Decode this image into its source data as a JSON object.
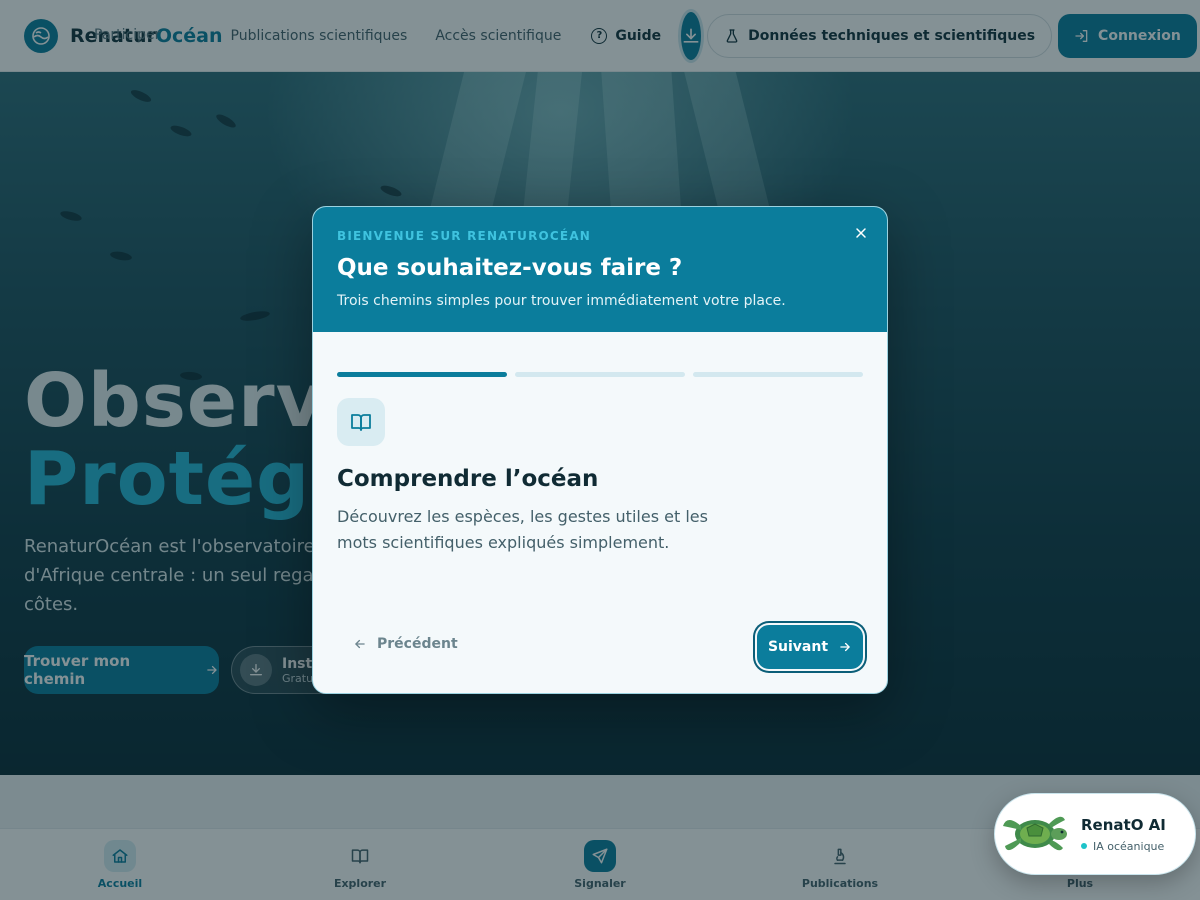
{
  "nav": {
    "brand_part1": "Renatur",
    "brand_part2": "Océan",
    "overlap_text": "Participer",
    "links": [
      "Participer",
      "Publications scientifiques",
      "Accès scientifique"
    ],
    "guide_label": "Guide",
    "tech_label": "Données techniques et scientifiques",
    "login_label": "Connexion"
  },
  "hero": {
    "title_line1": "Observer.",
    "title_line2": "Protéger.",
    "description": "RenaturOcéan est l'observatoire numérique des océans d'Afrique centrale : un seul regard sur la vie de nos côtes.",
    "cta_label": "Trouver mon chemin",
    "install_label": "Installer l'app",
    "install_sub": "Gratuit"
  },
  "modal": {
    "eyebrow": "BIENVENUE SUR RENATUROCÉAN",
    "title": "Que souhaitez-vous faire ?",
    "subtitle": "Trois chemins simples pour trouver immédiatement votre place.",
    "progress": {
      "current": 1,
      "total": 3
    },
    "step_title": "Comprendre l’océan",
    "step_description": "Découvrez les espèces, les gestes utiles et les mots scientifiques expliqués simplement.",
    "prev_label": "Précédent",
    "next_label": "Suivant"
  },
  "bottom_nav": {
    "items": [
      {
        "label": "Accueil",
        "icon": "home-icon",
        "active": true
      },
      {
        "label": "Explorer",
        "icon": "book-icon",
        "active": false
      },
      {
        "label": "Signaler",
        "icon": "send-icon",
        "active": false
      },
      {
        "label": "Publications",
        "icon": "microscope-icon",
        "active": false
      },
      {
        "label": "Plus",
        "icon": "more-icon",
        "active": false
      }
    ]
  },
  "chat": {
    "title": "RenatO AI",
    "subtitle": "IA océanique"
  },
  "colors": {
    "primary": "#0b7d9c",
    "accent": "#27b7d6",
    "online_dot": "#1ec3c9"
  }
}
